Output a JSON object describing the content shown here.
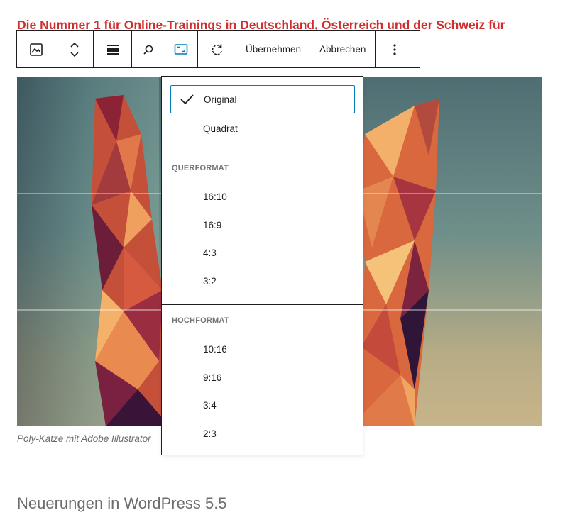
{
  "headline": "Die Nummer 1 für Online-Trainings in Deutschland, Österreich und der Schweiz für",
  "toolbar": {
    "icons": [
      "image-icon",
      "move-up-down-icon",
      "align-icon",
      "search-icon",
      "aspect-ratio-icon",
      "rotate-icon",
      "more-options-icon"
    ],
    "apply_label": "Übernehmen",
    "cancel_label": "Abbrechen"
  },
  "colors": {
    "headline": "#cf2e2e",
    "accent": "#007cba",
    "border": "#1e1e1e",
    "muted_text": "#6c6c6c"
  },
  "image": {
    "caption": "Poly-Katze mit Adobe Illustrator"
  },
  "aspect_menu": {
    "top_items": [
      {
        "label": "Original",
        "selected": true
      },
      {
        "label": "Quadrat",
        "selected": false
      }
    ],
    "groups": [
      {
        "title": "Querformat",
        "items": [
          "16:10",
          "16:9",
          "4:3",
          "3:2"
        ]
      },
      {
        "title": "Hochformat",
        "items": [
          "10:16",
          "9:16",
          "3:4",
          "2:3"
        ]
      }
    ]
  },
  "subheading": "Neuerungen in WordPress 5.5"
}
